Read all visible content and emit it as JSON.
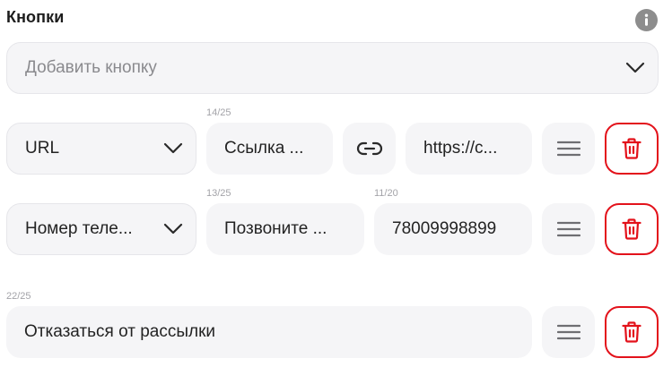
{
  "header": {
    "title": "Кнопки",
    "info_icon": "info-icon"
  },
  "add_button": {
    "placeholder": "Добавить кнопку",
    "icon": "chevron-down-icon"
  },
  "rows": [
    {
      "type_select": "URL",
      "label_counter": "14/25",
      "label_value": "Ссылка ...",
      "link_icon": "link-icon",
      "url_value": "https://c...",
      "drag_icon": "drag-handle-icon",
      "delete_icon": "trash-icon"
    },
    {
      "type_select": "Номер теле...",
      "label_counter": "13/25",
      "label_value": "Позвоните ...",
      "phone_counter": "11/20",
      "phone_value": "78009998899",
      "drag_icon": "drag-handle-icon",
      "delete_icon": "trash-icon"
    },
    {
      "label_counter": "22/25",
      "label_value": "Отказаться от рассылки",
      "drag_icon": "drag-handle-icon",
      "delete_icon": "trash-icon"
    }
  ],
  "colors": {
    "delete": "#e3121b",
    "field_bg": "#f5f5f7",
    "icon": "#8d8d8d"
  }
}
